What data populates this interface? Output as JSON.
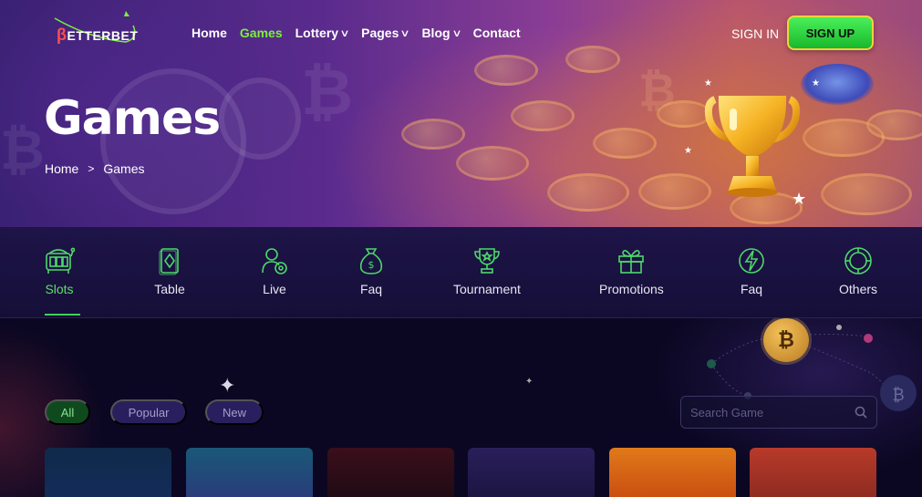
{
  "brand": {
    "logo_text": "ETTERBET",
    "logo_initial": "β"
  },
  "nav": {
    "items": [
      {
        "label": "Home",
        "active": false,
        "dropdown": false
      },
      {
        "label": "Games",
        "active": true,
        "dropdown": false
      },
      {
        "label": "Lottery",
        "active": false,
        "dropdown": true
      },
      {
        "label": "Pages",
        "active": false,
        "dropdown": true
      },
      {
        "label": "Blog",
        "active": false,
        "dropdown": true
      },
      {
        "label": "Contact",
        "active": false,
        "dropdown": false
      }
    ],
    "sign_in": "SIGN IN",
    "sign_up": "SIGN UP"
  },
  "hero": {
    "title": "Games",
    "breadcrumb": [
      "Home",
      "Games"
    ]
  },
  "categories": [
    {
      "label": "Slots",
      "icon": "slot-machine-icon",
      "active": true
    },
    {
      "label": "Table",
      "icon": "card-diamond-icon",
      "active": false
    },
    {
      "label": "Live",
      "icon": "live-dealer-icon",
      "active": false
    },
    {
      "label": "Faq",
      "icon": "money-bag-icon",
      "active": false
    },
    {
      "label": "Tournament",
      "icon": "trophy-icon",
      "active": false
    },
    {
      "label": "Promotions",
      "icon": "gift-icon",
      "active": false
    },
    {
      "label": "Faq",
      "icon": "lightning-icon",
      "active": false
    },
    {
      "label": "Others",
      "icon": "chip-icon",
      "active": false
    }
  ],
  "filters": {
    "all": "All",
    "popular": "Popular",
    "new": "New"
  },
  "search": {
    "placeholder": "Search Game",
    "value": ""
  },
  "colors": {
    "accent_green": "#5be06a",
    "nav_active": "#7bf03a",
    "signup_border": "#f2d23a",
    "bg_dark": "#0c0827"
  }
}
